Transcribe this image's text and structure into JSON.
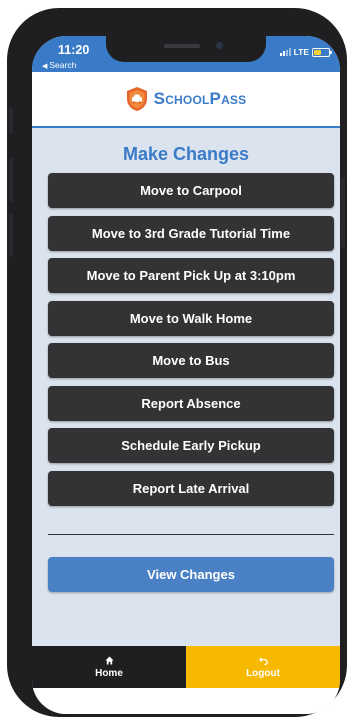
{
  "status_bar": {
    "time": "11:20",
    "back_label": "Search",
    "network": "LTE",
    "battery_color": "#f5d13a"
  },
  "header": {
    "logo_text": "SchoolPass",
    "logo_icon": "shield-car-icon",
    "brand_color": "#3a7bc8"
  },
  "main": {
    "title": "Make Changes",
    "actions": [
      {
        "label": "Move to Carpool"
      },
      {
        "label": "Move to 3rd Grade Tutorial Time"
      },
      {
        "label": "Move to Parent Pick Up at 3:10pm"
      },
      {
        "label": "Move to Walk Home"
      },
      {
        "label": "Move to Bus"
      },
      {
        "label": "Report Absence"
      },
      {
        "label": "Schedule Early Pickup"
      },
      {
        "label": "Report Late Arrival"
      }
    ],
    "view_changes_label": "View Changes"
  },
  "tabbar": {
    "home": {
      "label": "Home",
      "icon": "home-icon"
    },
    "logout": {
      "label": "Logout",
      "icon": "logout-icon",
      "color": "#f7b800"
    }
  }
}
